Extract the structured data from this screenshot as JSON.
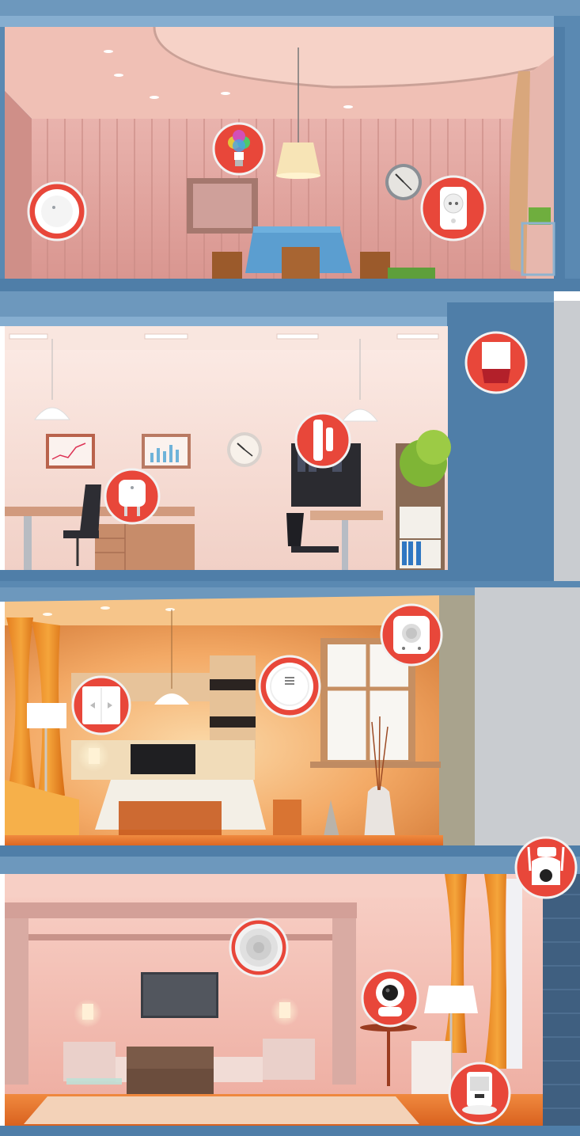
{
  "image": {
    "description_free": true
  },
  "colors": {
    "wall_blue": "#4f7ea8",
    "wall_blue_dark": "#3c6690",
    "wall_blue_light": "#6d98bd",
    "marker_red": "#e8473a",
    "marker_ring": "#f2f2f2",
    "floor1_wall": "#e2a7a2",
    "floor1_ceiling": "#f0c0b5",
    "floor2_wall": "#f7ddd6",
    "floor2_ceiling": "#f9e6df",
    "floor3_wall": "#f2a35d",
    "floor3_ceiling": "#f6c58a",
    "floor4_wall": "#f3b8ad",
    "floor4_ceiling": "#f7cfc5",
    "floor_orange": "#e36f2c",
    "brick": "#3f5f80",
    "grey_exterior": "#c9ccd0"
  },
  "rooms": [
    {
      "name": "dining-room",
      "floor": 1
    },
    {
      "name": "office",
      "floor": 2
    },
    {
      "name": "living-room",
      "floor": 3
    },
    {
      "name": "lounge",
      "floor": 4
    }
  ],
  "devices": [
    {
      "id": "motion-sensor",
      "icon": "motion-sensor-icon"
    },
    {
      "id": "smart-bulb",
      "icon": "rgb-bulb-icon"
    },
    {
      "id": "smart-socket-eu",
      "icon": "wall-socket-icon"
    },
    {
      "id": "siren",
      "icon": "siren-icon"
    },
    {
      "id": "door-sensor",
      "icon": "door-window-sensor-icon"
    },
    {
      "id": "smart-plug",
      "icon": "smart-plug-icon"
    },
    {
      "id": "gas-detector",
      "icon": "gas-detector-icon"
    },
    {
      "id": "smoke-detector",
      "icon": "smoke-detector-icon"
    },
    {
      "id": "curtain-switch",
      "icon": "wall-switch-icon"
    },
    {
      "id": "outdoor-camera",
      "icon": "ptz-camera-icon"
    },
    {
      "id": "hub-speaker",
      "icon": "hub-speaker-icon"
    },
    {
      "id": "indoor-camera",
      "icon": "indoor-camera-icon"
    },
    {
      "id": "pet-feeder",
      "icon": "pet-feeder-icon"
    }
  ]
}
